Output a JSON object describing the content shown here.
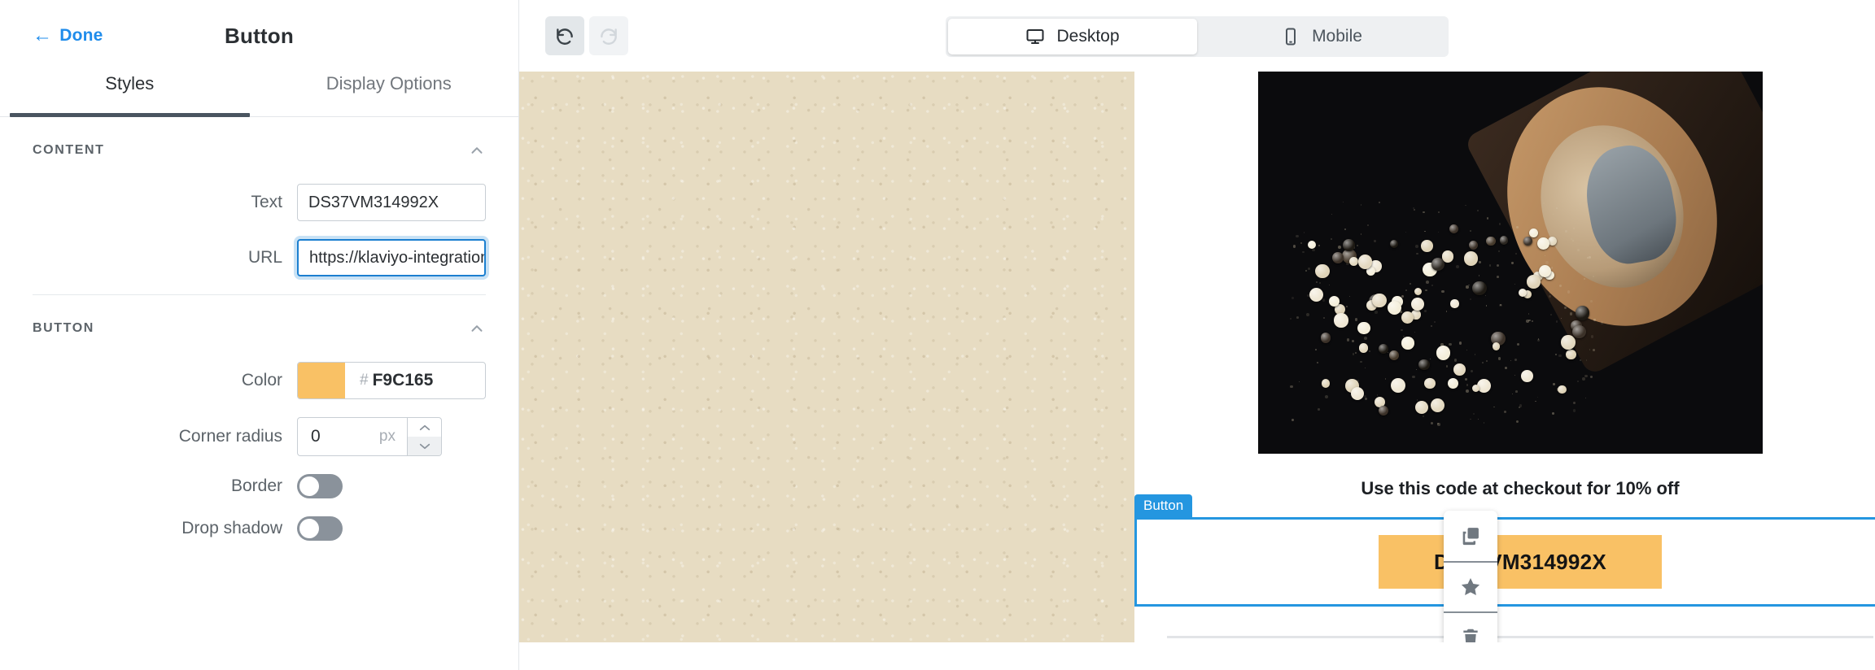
{
  "sidebar": {
    "done_label": "Done",
    "back_arrow": "←",
    "title": "Button",
    "tabs": [
      {
        "label": "Styles",
        "active": true
      },
      {
        "label": "Display Options",
        "active": false
      }
    ],
    "sections": [
      {
        "title": "CONTENT",
        "collapse_icon": "chevron-up-icon",
        "fields": [
          {
            "label": "Text",
            "value": "DS37VM314992X",
            "focused": false
          },
          {
            "label": "URL",
            "value": "https://klaviyo-integrations.squa",
            "focused": true
          }
        ]
      },
      {
        "title": "BUTTON",
        "collapse_icon": "chevron-up-icon",
        "color": {
          "label": "Color",
          "hash": "#",
          "hex": "F9C165",
          "swatch": "#F9C165"
        },
        "corner_radius": {
          "label": "Corner radius",
          "value": "0",
          "unit": "px"
        },
        "border": {
          "label": "Border",
          "on": false
        },
        "drop_shadow": {
          "label": "Drop shadow",
          "on": false
        }
      }
    ]
  },
  "toolbar": {
    "undo": {
      "icon": "undo-icon",
      "enabled": true
    },
    "redo": {
      "icon": "redo-icon",
      "enabled": false
    },
    "devices": [
      {
        "label": "Desktop",
        "icon": "desktop-icon",
        "active": true
      },
      {
        "label": "Mobile",
        "icon": "mobile-icon",
        "active": false
      }
    ]
  },
  "canvas": {
    "background_color": "#E7DCC2",
    "email": {
      "hero_image_alt": "pepper-mill-with-peppercorns",
      "caption": "Use this code at checkout for 10% off",
      "selected_block": {
        "tag_label": "Button",
        "tag_color": "#2496E0",
        "button_label": "DS37VM314992X",
        "button_color": "#F9C165",
        "button_text_color": "#141414"
      }
    },
    "float_tools": [
      {
        "name": "duplicate-icon"
      },
      {
        "name": "star-icon"
      },
      {
        "name": "trash-icon"
      }
    ]
  }
}
